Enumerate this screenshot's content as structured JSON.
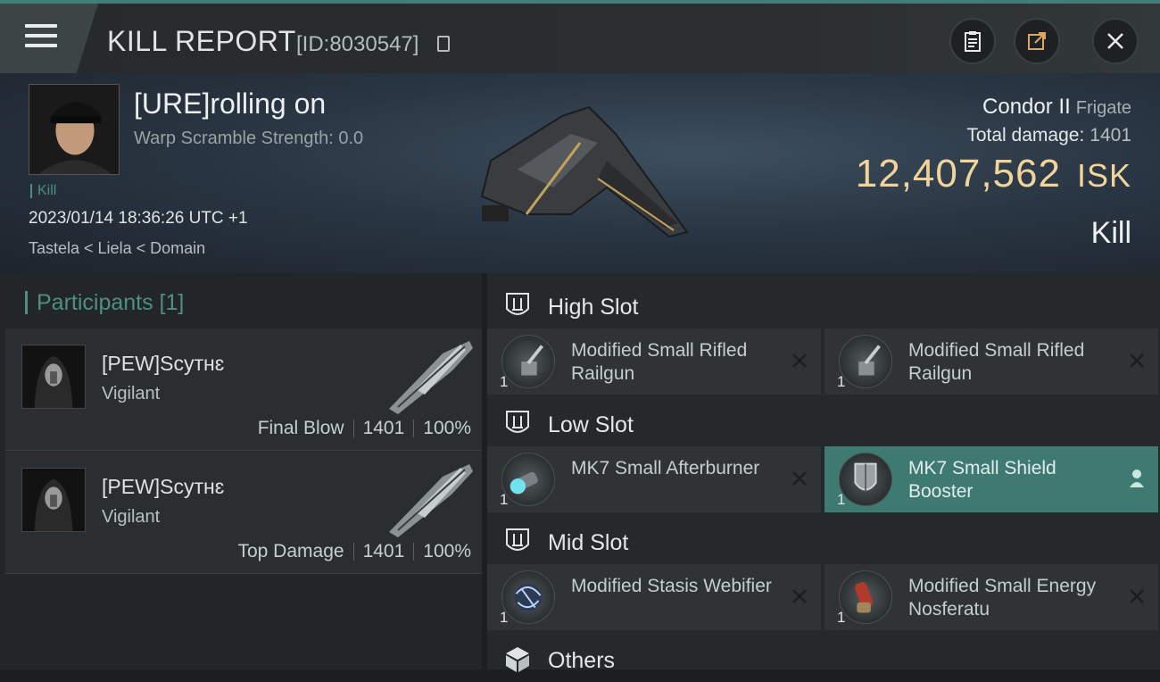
{
  "window": {
    "title": "KILL REPORT",
    "report_id": "[ID:8030547]"
  },
  "victim": {
    "name": "[URE]rolling on",
    "warp_scramble": "Warp Scramble Strength: 0.0",
    "tag": "Kill",
    "datetime": "2023/01/14 18:36:26 UTC +1",
    "location": "Tastela < Liela < Domain",
    "ship_name": "Condor II",
    "ship_class": "Frigate",
    "total_damage_label": "Total damage:",
    "total_damage": "1401",
    "isk_value": "12,407,562",
    "isk_unit": "ISK",
    "result": "Kill"
  },
  "participants": {
    "title": "Participants [1]",
    "items": [
      {
        "name": "[PEW]Scутнɛ",
        "ship": "Vigilant",
        "role": "Final Blow",
        "damage": "1401",
        "percent": "100%"
      },
      {
        "name": "[PEW]Scутнɛ",
        "ship": "Vigilant",
        "role": "Top Damage",
        "damage": "1401",
        "percent": "100%"
      }
    ]
  },
  "fitting": {
    "high_slot": {
      "title": "High Slot",
      "modules": [
        {
          "name": "Modified Small Rifled Railgun",
          "qty": "1"
        },
        {
          "name": "Modified Small Rifled Railgun",
          "qty": "1"
        }
      ]
    },
    "low_slot": {
      "title": "Low Slot",
      "modules": [
        {
          "name": "MK7 Small Afterburner",
          "qty": "1"
        },
        {
          "name": "MK7 Small Shield Booster",
          "qty": "1"
        }
      ]
    },
    "mid_slot": {
      "title": "Mid Slot",
      "modules": [
        {
          "name": "Modified Stasis Webifier",
          "qty": "1"
        },
        {
          "name": "Modified Small Energy Nosferatu",
          "qty": "1"
        }
      ]
    },
    "others": {
      "title": "Others"
    }
  },
  "colors": {
    "accent": "#4f8e82",
    "isk": "#f2d49a",
    "highlight_row": "#3f7a72"
  }
}
